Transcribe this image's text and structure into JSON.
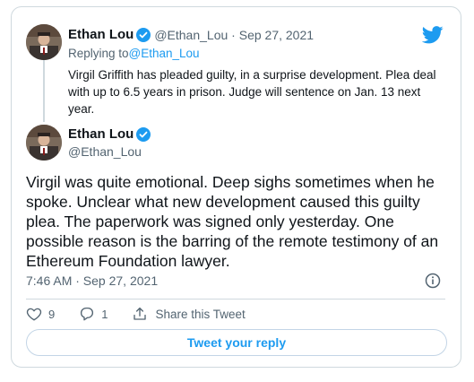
{
  "quoted_tweet": {
    "author_name": "Ethan Lou",
    "handle": "@Ethan_Lou",
    "date": "Sep 27, 2021",
    "replying_prefix": "Replying to ",
    "replying_to": "@Ethan_Lou",
    "text": "Virgil Griffith has pleaded guilty, in a surprise development. Plea deal with up to 6.5 years in prison. Judge will sentence on Jan. 13 next year."
  },
  "main_tweet": {
    "author_name": "Ethan Lou",
    "handle": "@Ethan_Lou",
    "text": "Virgil was quite emotional. Deep sighs sometimes when he spoke. Unclear what new development caused this guilty plea. The paperwork was signed only yesterday. One possible reason is the barring of the remote testimony of an Ethereum Foundation lawyer.",
    "timestamp": "7:46 AM · Sep 27, 2021"
  },
  "actions": {
    "like_count": "9",
    "reply_count": "1",
    "share_label": "Share this Tweet"
  },
  "reply_button_label": "Tweet your reply",
  "colors": {
    "accent": "#1d9bf0",
    "border": "#cfd9de",
    "muted": "#536471",
    "verified_badge": "#1d9bf0"
  },
  "icons": [
    "twitter-bird-icon",
    "verified-badge-icon",
    "info-icon",
    "heart-icon",
    "reply-icon",
    "share-icon"
  ]
}
